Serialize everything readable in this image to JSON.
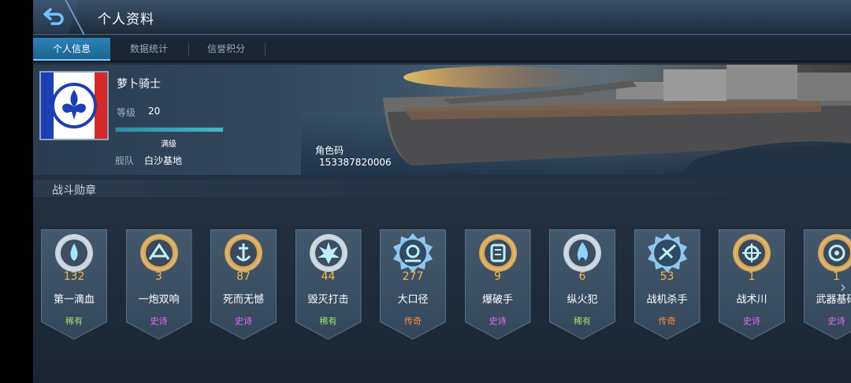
{
  "header": {
    "title": "个人资料",
    "back_icon": "back-arrow-icon"
  },
  "tabs": [
    {
      "label": "个人信息",
      "active": true
    },
    {
      "label": "数据统计",
      "active": false
    },
    {
      "label": "信誉积分",
      "active": false
    }
  ],
  "profile": {
    "name": "萝卜骑士",
    "level_label": "等级",
    "level": "20",
    "exp_fraction": 1.0,
    "exp_text": "满级",
    "fleet_label": "舰队",
    "fleet": "白沙基地",
    "role_code_label": "角色码",
    "role_code": "153387820006",
    "avatar_icon": "fleur-de-lis-icon"
  },
  "medals_section": {
    "title": "战斗勋章",
    "items": [
      {
        "count": "132",
        "name": "第一滴血",
        "rarity": "稀有",
        "rarity_color": "#9be36d",
        "frame": "silver",
        "icon": "droplet-icon"
      },
      {
        "count": "3",
        "name": "一炮双响",
        "rarity": "史诗",
        "rarity_color": "#e46bff",
        "frame": "gold",
        "icon": "burst-icon"
      },
      {
        "count": "87",
        "name": "死而无憾",
        "rarity": "史诗",
        "rarity_color": "#e46bff",
        "frame": "gold",
        "icon": "anchor-icon"
      },
      {
        "count": "44",
        "name": "毁灭打击",
        "rarity": "稀有",
        "rarity_color": "#9be36d",
        "frame": "silver",
        "icon": "explosion-icon"
      },
      {
        "count": "277",
        "name": "大口径",
        "rarity": "传奇",
        "rarity_color": "#ff8c3a",
        "frame": "cog",
        "icon": "cannon-icon"
      },
      {
        "count": "9",
        "name": "爆破手",
        "rarity": "史诗",
        "rarity_color": "#e46bff",
        "frame": "gold",
        "icon": "torpedo-icon"
      },
      {
        "count": "6",
        "name": "纵火犯",
        "rarity": "稀有",
        "rarity_color": "#9be36d",
        "frame": "silver",
        "icon": "flame-icon"
      },
      {
        "count": "53",
        "name": "战机杀手",
        "rarity": "传奇",
        "rarity_color": "#ff8c3a",
        "frame": "cog",
        "icon": "plane-icon"
      },
      {
        "count": "1",
        "name": "战术川",
        "rarity": "史诗",
        "rarity_color": "#e46bff",
        "frame": "gold",
        "icon": "crosshair-icon"
      },
      {
        "count": "1",
        "name": "武器基础",
        "rarity": "史诗",
        "rarity_color": "#e46bff",
        "frame": "gold",
        "icon": "weapon-icon"
      }
    ]
  },
  "colors": {
    "accent": "#2b83b6",
    "count": "#f0b84c",
    "rare": "#9be36d",
    "epic": "#e46bff",
    "legendary": "#ff8c3a"
  },
  "scroll_icon": "chevron-right-icon"
}
